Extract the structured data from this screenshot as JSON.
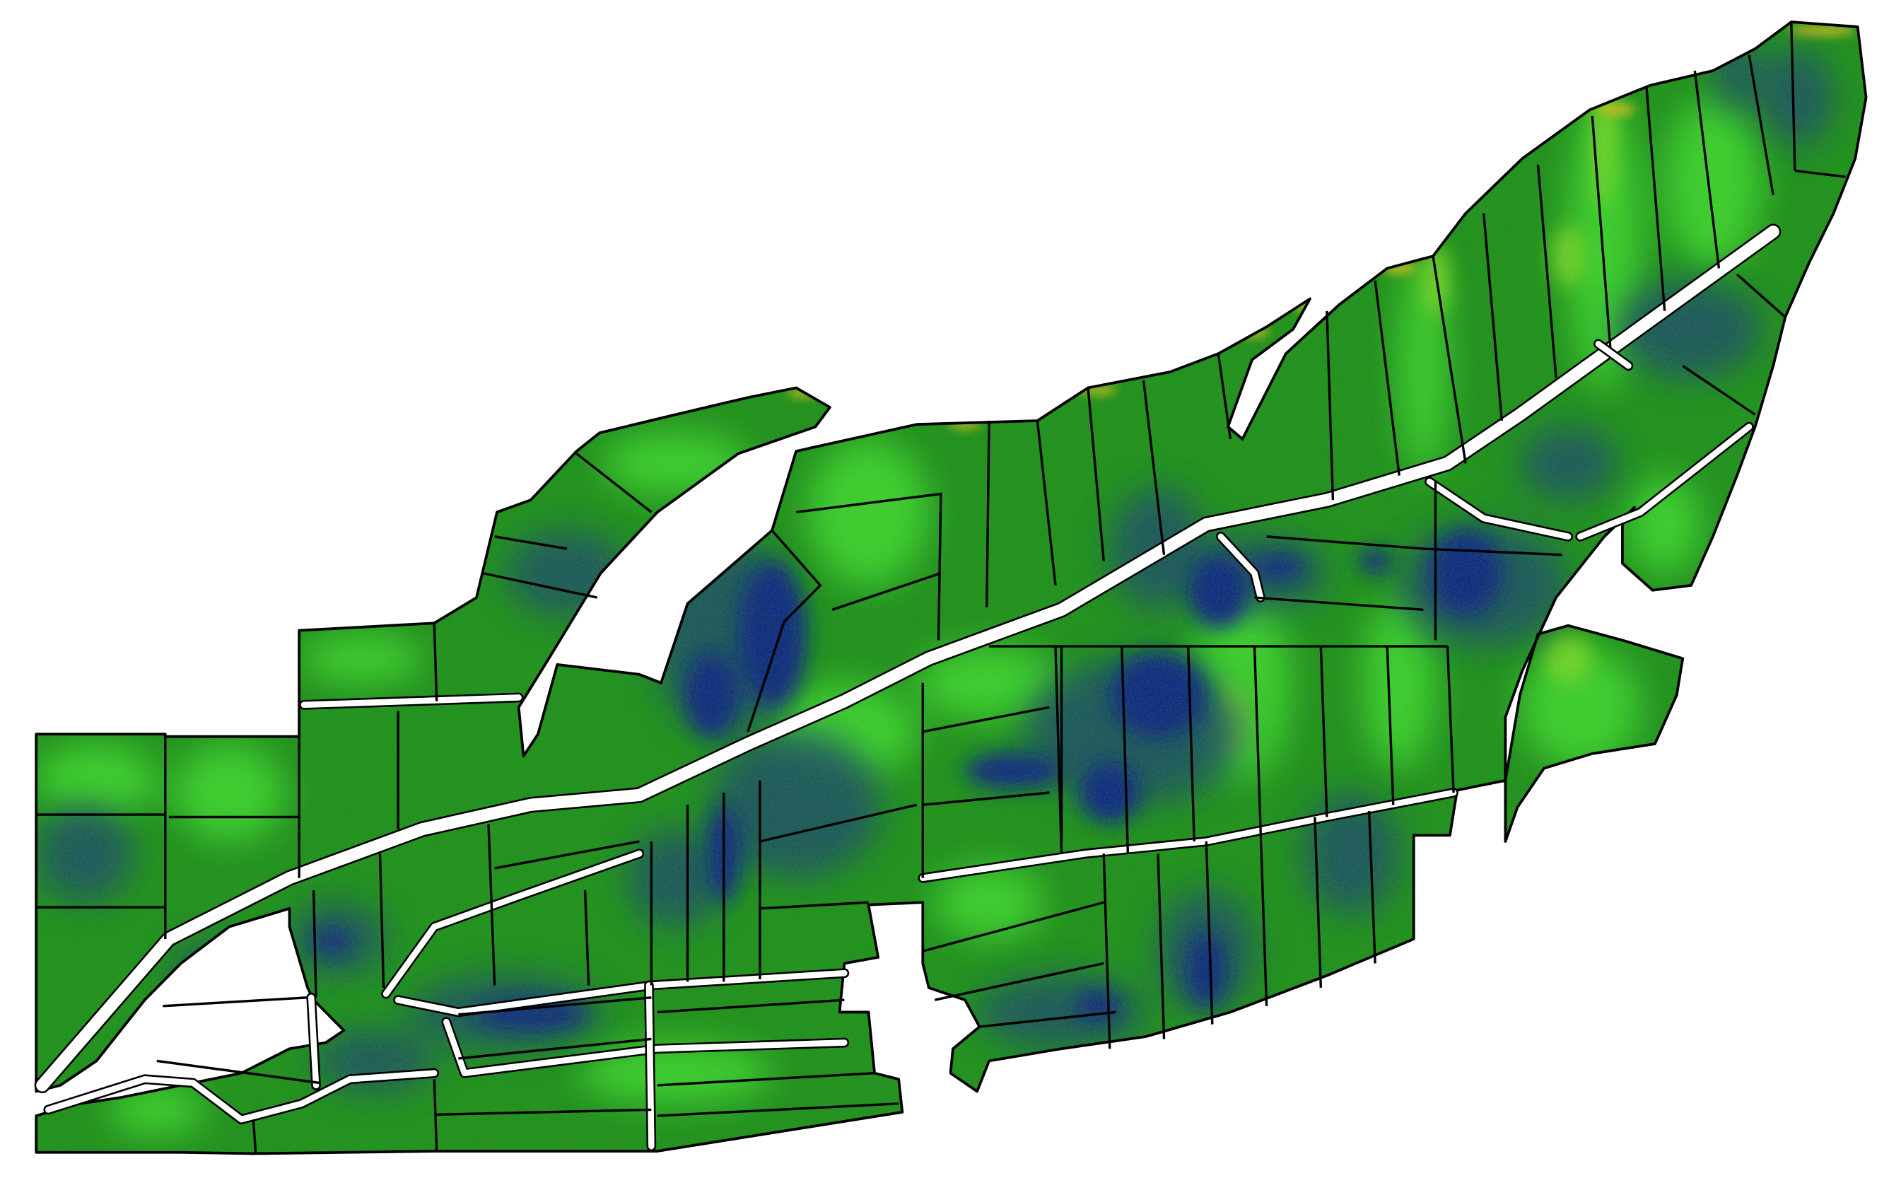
{
  "map": {
    "type": "vegetation-index field map",
    "background": "#ffffff",
    "palette": {
      "field_base": "#1f8f1a",
      "high": "#3fd52e",
      "very_high": "#9be000",
      "edge_yellow": "#e8c21a",
      "low": "#1c4a6a",
      "very_low": "#0d1a8c",
      "boundary": "#000000",
      "road": "#ffffff"
    }
  }
}
